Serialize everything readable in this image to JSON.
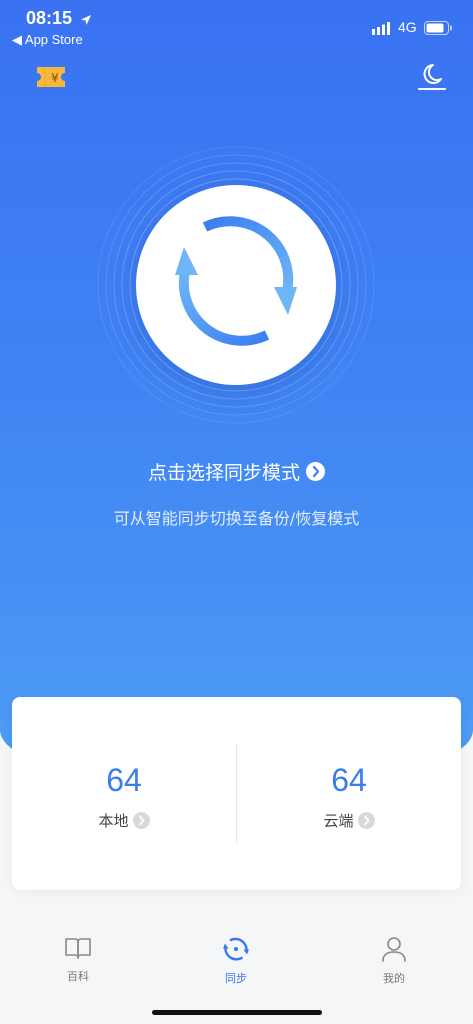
{
  "status_bar": {
    "time": "08:15",
    "back_label": "◀ App Store",
    "network": "4G"
  },
  "header": {
    "coupon_symbol": "¥",
    "left_icon": "coupon-icon",
    "right_icon": "moon-icon"
  },
  "sync": {
    "title": "点击选择同步模式",
    "subtitle": "可从智能同步切换至备份/恢复模式"
  },
  "stats": {
    "local": {
      "count": "64",
      "label": "本地"
    },
    "cloud": {
      "count": "64",
      "label": "云端"
    }
  },
  "tabs": [
    {
      "label": "百科",
      "icon": "book-icon",
      "active": false
    },
    {
      "label": "同步",
      "icon": "sync-icon",
      "active": true
    },
    {
      "label": "我的",
      "icon": "person-icon",
      "active": false
    }
  ],
  "colors": {
    "accent": "#3a78ee",
    "hero_top": "#3a72f2",
    "hero_bottom": "#4d9ef5",
    "number": "#3c7ee8"
  }
}
